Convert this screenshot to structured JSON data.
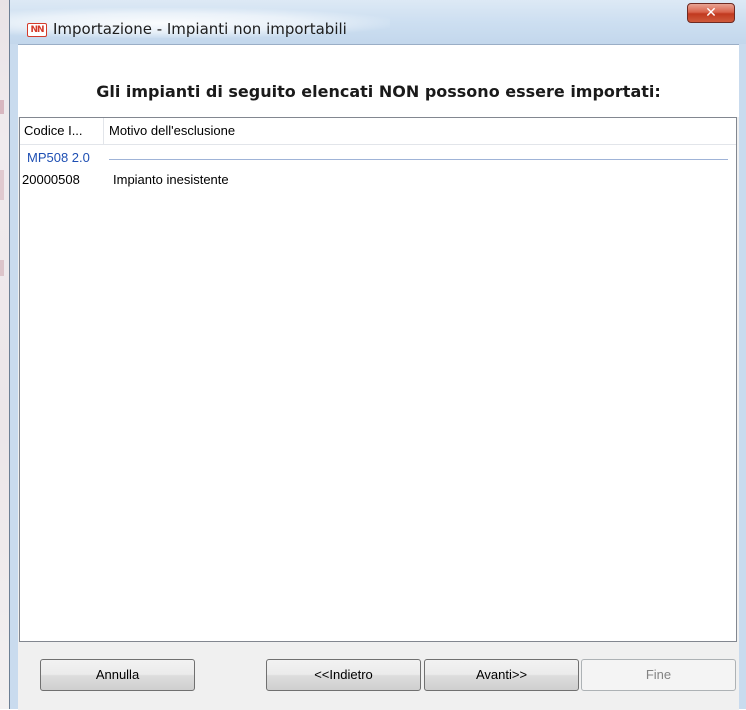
{
  "window": {
    "title": "Importazione - Impianti non importabili",
    "icon": "nn-app-icon",
    "close_glyph": "✕"
  },
  "header": {
    "heading": "Gli impianti di seguito elencati NON possono essere importati:"
  },
  "list": {
    "columns": [
      "Codice I...",
      "Motivo dell'esclusione"
    ],
    "groups": [
      {
        "label": "MP508 2.0",
        "rows": [
          {
            "code": "20000508",
            "reason": "Impianto inesistente"
          }
        ]
      }
    ]
  },
  "buttons": {
    "cancel": "Annulla",
    "back": "<<Indietro",
    "next": "Avanti>>",
    "finish": "Fine"
  },
  "colors": {
    "group_label": "#1e4fb3",
    "close_button": "#c1391f",
    "titlebar": "#cddff1"
  }
}
